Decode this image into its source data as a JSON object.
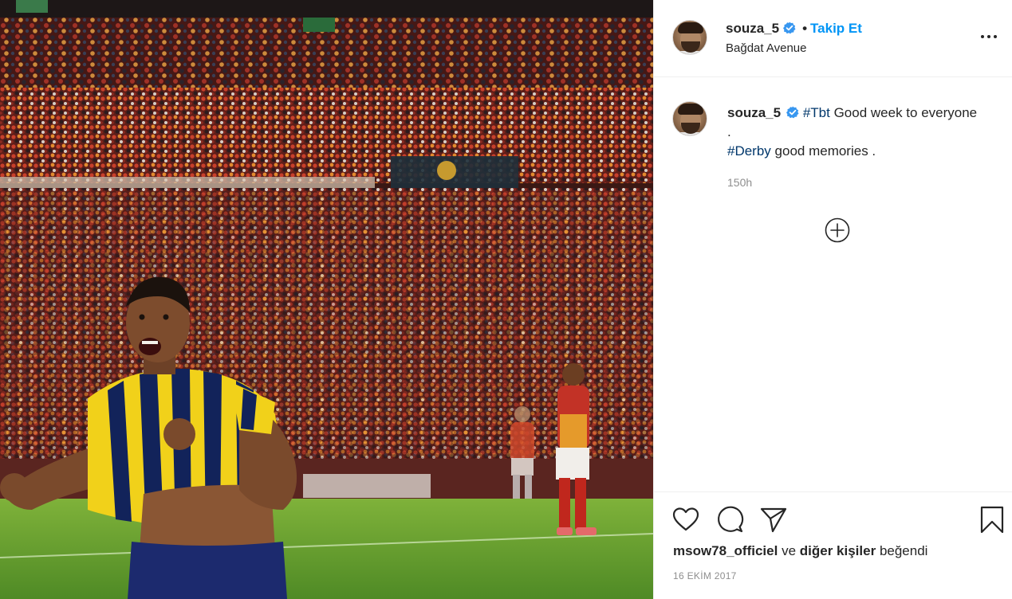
{
  "post": {
    "username": "souza_5",
    "follow_label": "Takip Et",
    "separator": "•",
    "location": "Bağdat Avenue",
    "caption": {
      "hashtag_1": "#Tbt",
      "line_1": " Good week to everyone .",
      "hashtag_2": "#Derby",
      "line_2": " good memories ."
    },
    "time_ago": "150h",
    "likes": {
      "user": "msow78_officiel",
      "conj": "ve",
      "others": "diğer kişiler",
      "suffix": "beğendi"
    },
    "date": "16 EKİM 2017"
  },
  "icons": {
    "verified": "verified-badge-icon",
    "more": "more-options-icon",
    "plus": "add-circle-icon",
    "like": "heart-icon",
    "comment": "comment-icon",
    "share": "paper-plane-icon",
    "save": "bookmark-icon"
  },
  "colors": {
    "follow": "#0095f6",
    "hashtag": "#00376b",
    "muted": "#8e8e8e",
    "verified": "#3897f0"
  }
}
